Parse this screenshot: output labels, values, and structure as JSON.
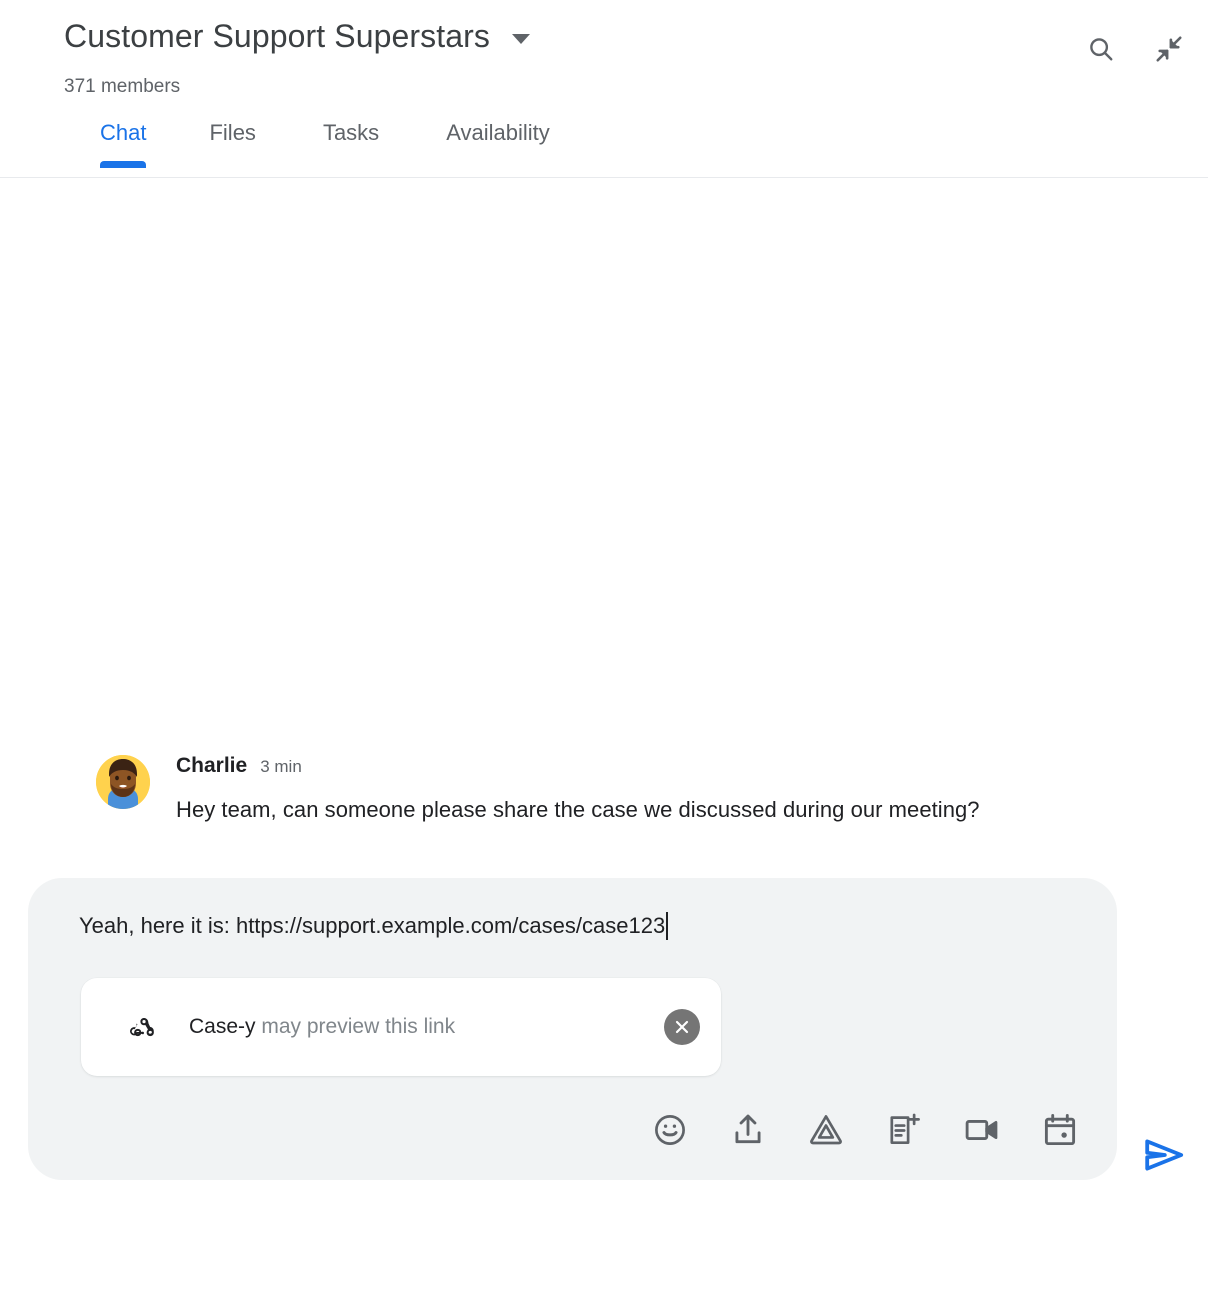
{
  "header": {
    "title": "Customer Support Superstars",
    "caret_icon": "chevron-down-icon",
    "member_count": "371 members",
    "search_icon": "search-icon",
    "collapse_icon": "collapse-icon"
  },
  "tabs": [
    {
      "label": "Chat",
      "active": true
    },
    {
      "label": "Files",
      "active": false
    },
    {
      "label": "Tasks",
      "active": false
    },
    {
      "label": "Availability",
      "active": false
    }
  ],
  "messages": [
    {
      "author": "Charlie",
      "time": "3 min",
      "text": "Hey team, can someone please share the case we discussed during our meeting?",
      "avatar_name": "avatar-charlie"
    }
  ],
  "composer": {
    "draft_text": "Yeah, here it is: https://support.example.com/cases/case123",
    "link_preview": {
      "app_icon": "webhook-icon",
      "app_name": "Case-y",
      "note": " may preview this link",
      "close_icon": "close-icon"
    },
    "tools": [
      {
        "name": "emoji-icon",
        "label": "Emoji"
      },
      {
        "name": "upload-icon",
        "label": "Upload file"
      },
      {
        "name": "google-drive-icon",
        "label": "Google Drive"
      },
      {
        "name": "new-document-icon",
        "label": "New document"
      },
      {
        "name": "video-call-icon",
        "label": "Video meeting"
      },
      {
        "name": "calendar-icon",
        "label": "Calendar invite"
      }
    ],
    "send": {
      "name": "send-icon",
      "label": "Send"
    }
  },
  "colors": {
    "accent": "#1a73e8",
    "text_primary": "#202124",
    "text_secondary": "#5f6368",
    "composer_bg": "#f1f3f4",
    "divider": "#e8eaed",
    "close_bg": "#757575"
  }
}
